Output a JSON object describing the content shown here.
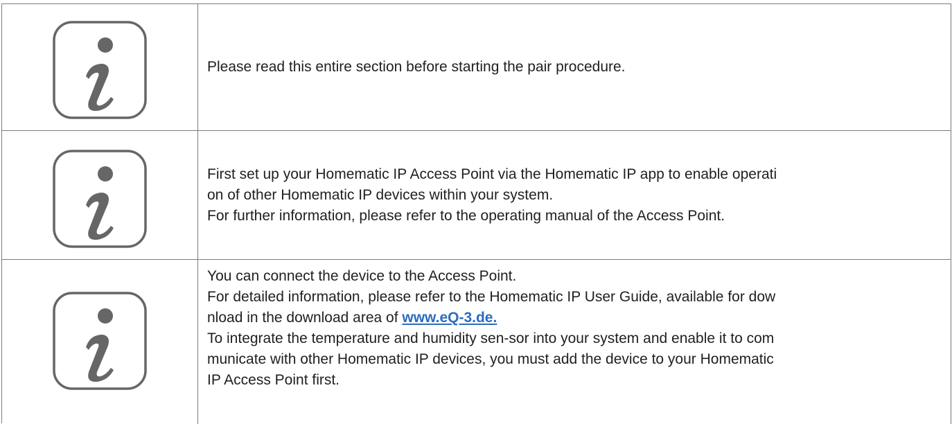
{
  "notes": [
    {
      "icon": "info-icon",
      "lines": [
        "Please read this entire section before starting the pair procedure."
      ]
    },
    {
      "icon": "info-icon",
      "lines": [
        "First set up your Homematic IP Access Point via the Homematic IP app to enable operati",
        "on of other Homematic IP devices within your system.",
        "For further information, please refer to the operating manual of the Access Point."
      ]
    },
    {
      "icon": "info-icon",
      "lines": [
        "You can connect the device to the Access Point.",
        "For detailed information, please refer to the Homematic IP User Guide, available for dow",
        "nload in the download area of ",
        "To integrate the temperature and humidity sen-sor into your system and enable it to com",
        "municate with other Homematic IP devices, you must add the device to your Homematic",
        "IP Access Point first."
      ],
      "link_text": "www.eQ-3.de."
    }
  ],
  "colors": {
    "border": "#7a7a7a",
    "icon_stroke": "#666666",
    "link": "#2a6cc0",
    "text": "#1f1f1f"
  }
}
